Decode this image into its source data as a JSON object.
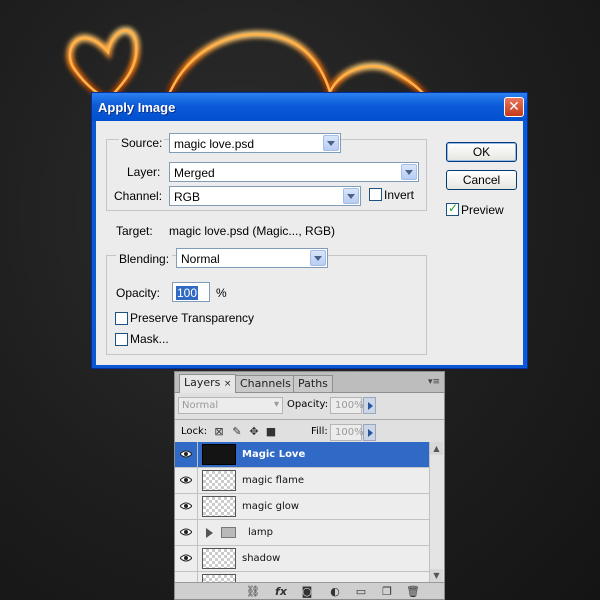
{
  "dialog": {
    "title": "Apply Image",
    "close_glyph": "✕",
    "source_label": "Source:",
    "source_value": "magic love.psd",
    "layer_label": "Layer:",
    "layer_value": "Merged",
    "channel_label": "Channel:",
    "channel_value": "RGB",
    "invert_label": "Invert",
    "invert_checked": false,
    "target_label": "Target:",
    "target_value": "magic love.psd (Magic..., RGB)",
    "blending_label": "Blending:",
    "blending_value": "Normal",
    "opacity_label": "Opacity:",
    "opacity_value": "100",
    "opacity_unit": "%",
    "preserve_label": "Preserve Transparency",
    "preserve_checked": false,
    "mask_label": "Mask...",
    "mask_checked": false,
    "ok_label": "OK",
    "cancel_label": "Cancel",
    "preview_label": "Preview",
    "preview_checked": true
  },
  "layers_panel": {
    "tabs": [
      {
        "label": "Layers",
        "close": "×"
      },
      {
        "label": "Channels"
      },
      {
        "label": "Paths"
      }
    ],
    "blend_mode": "Normal",
    "opacity_label": "Opacity:",
    "opacity_value": "100%",
    "lock_label": "Lock:",
    "fill_label": "Fill:",
    "fill_value": "100%",
    "layers": [
      {
        "name": "Magic Love",
        "selected": true,
        "type": "dark"
      },
      {
        "name": "magic flame",
        "selected": false,
        "type": "transparent"
      },
      {
        "name": "magic glow",
        "selected": false,
        "type": "transparent"
      },
      {
        "name": "lamp",
        "selected": false,
        "type": "group"
      },
      {
        "name": "shadow",
        "selected": false,
        "type": "transparent"
      }
    ],
    "footer_icons": [
      "link-icon",
      "fx-icon",
      "mask-icon",
      "adjustment-icon",
      "group-icon",
      "new-layer-icon",
      "trash-icon"
    ],
    "fx_label": "fx"
  },
  "colors": {
    "titlebar": "#0c5ad8",
    "selection": "#3169c6",
    "flame": "#ff8a1e"
  }
}
